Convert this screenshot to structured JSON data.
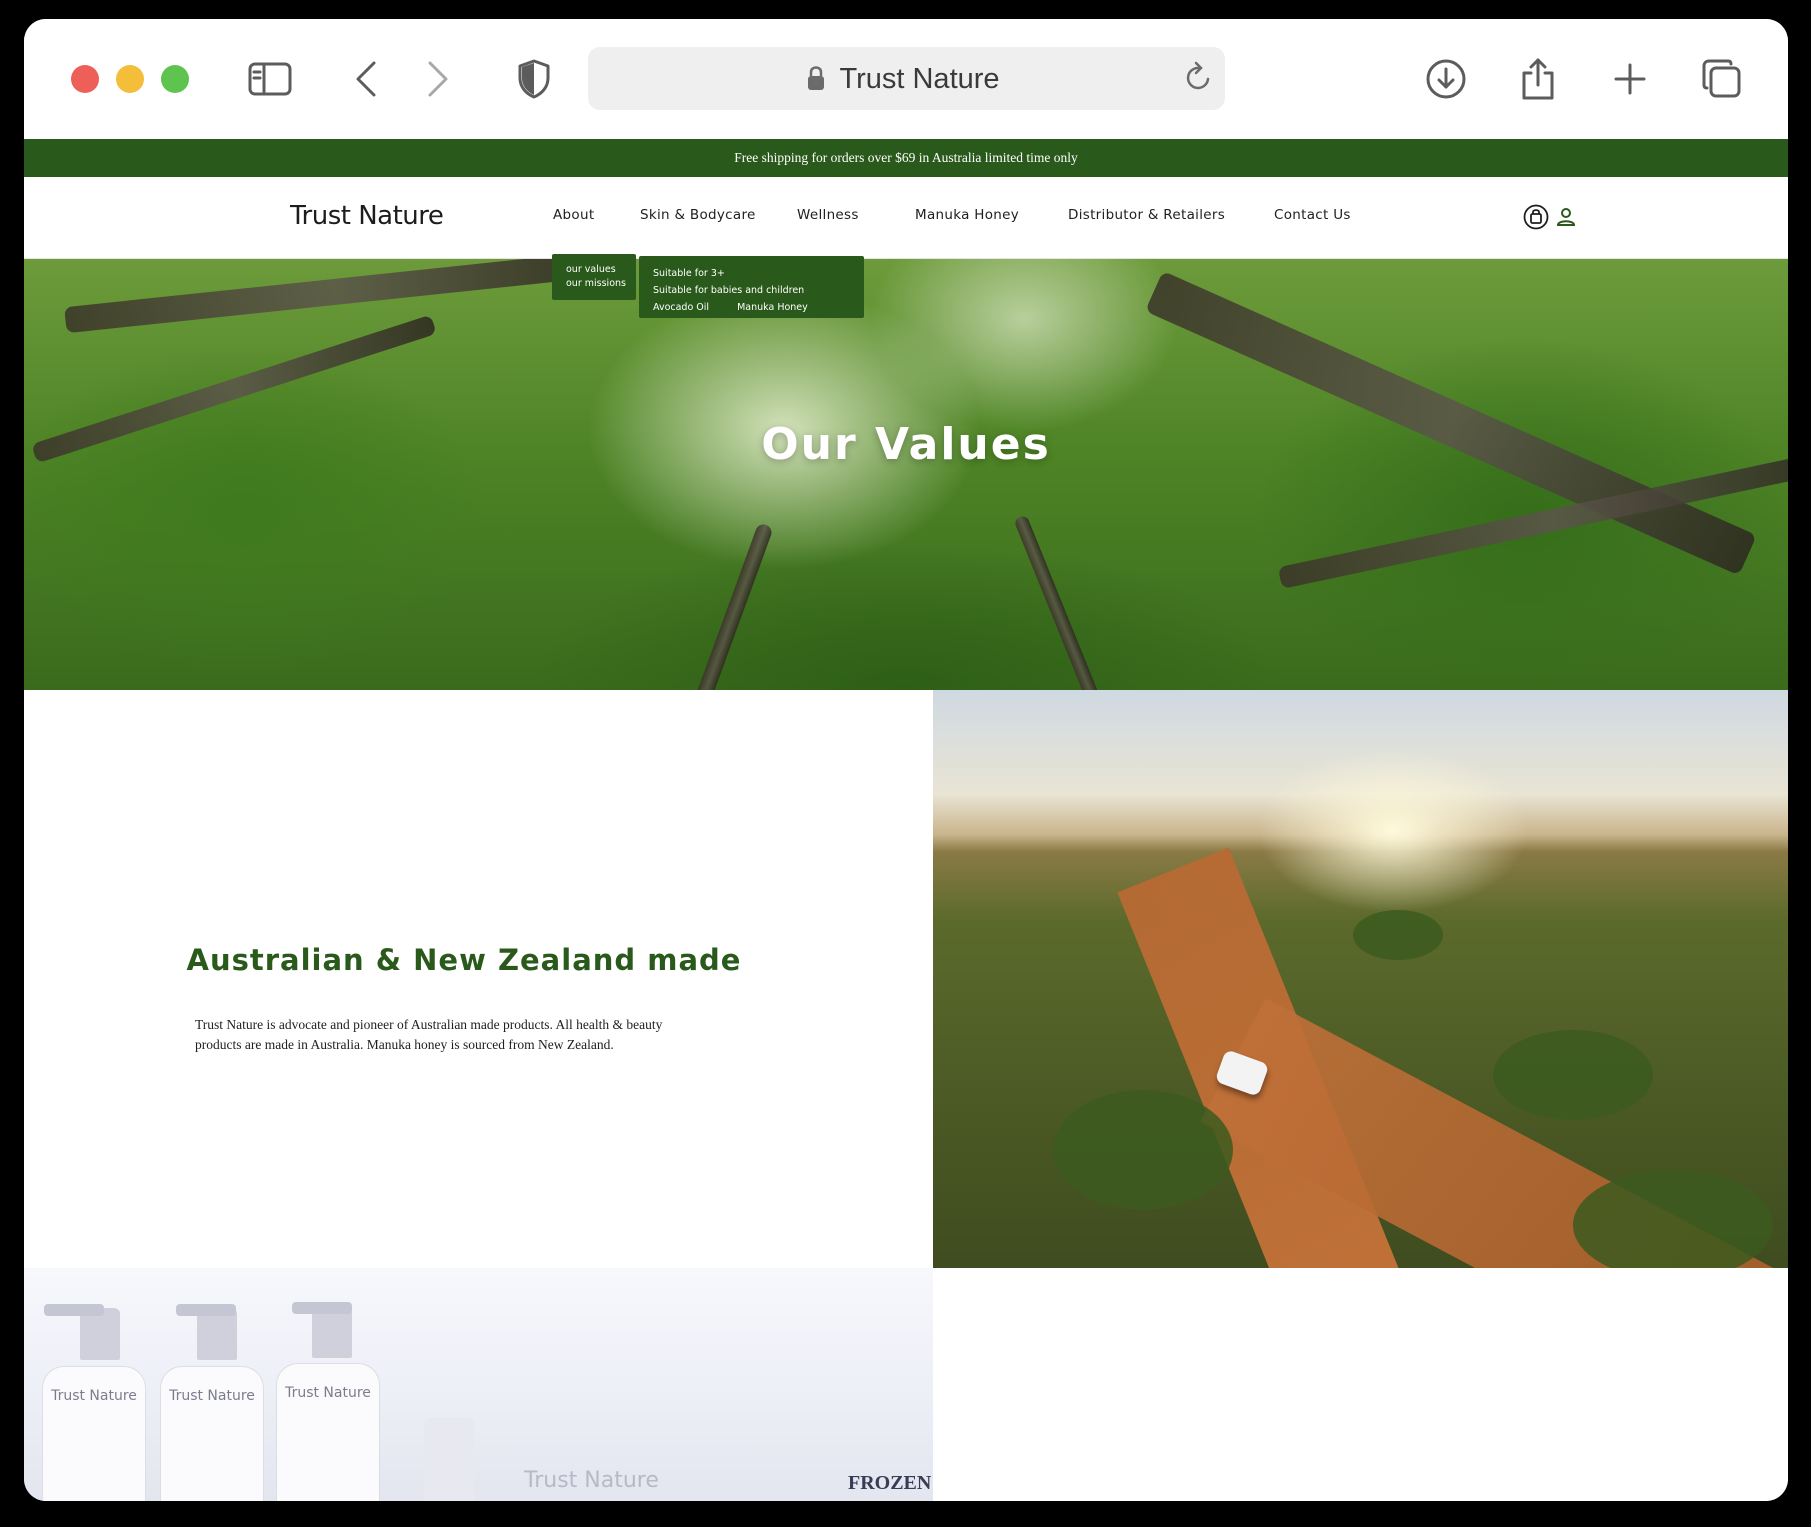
{
  "browser": {
    "address_title": "Trust Nature",
    "icons": [
      "sidebar-icon",
      "back-icon",
      "forward-icon",
      "shield-icon",
      "lock-icon",
      "reload-icon",
      "download-icon",
      "share-icon",
      "new-tab-icon",
      "tabs-icon"
    ]
  },
  "promo": {
    "text": "Free shipping for orders over $69 in Australia limited time only"
  },
  "header": {
    "logo": "Trust Nature",
    "nav": [
      {
        "label": "About"
      },
      {
        "label": "Skin & Bodycare"
      },
      {
        "label": "Wellness"
      },
      {
        "label": "Manuka Honey"
      },
      {
        "label": "Distributor & Retailers"
      },
      {
        "label": "Contact Us"
      }
    ],
    "icons": [
      "cart-icon",
      "account-icon"
    ]
  },
  "dropdowns": {
    "about": [
      "our values",
      "our missions"
    ],
    "skin": [
      "Suitable for 3+",
      "Suitable for babies and children",
      "Avocado Oil",
      "Manuka Honey"
    ]
  },
  "hero": {
    "title": "Our Values"
  },
  "made": {
    "heading": "Australian & New Zealand made",
    "text": "Trust Nature is advocate and pioneer of Australian made products. All health & beauty products are made in Australia. Manuka honey is sourced from New Zealand."
  },
  "products": {
    "bottle_labels": [
      "Trust Nature",
      "Trust Nature",
      "Trust Nature"
    ],
    "box_brand": "Trust Nature",
    "box_title": "FROZEN"
  },
  "colors": {
    "brand_green": "#2a5a1b",
    "promo_bg": "#2a5a1b",
    "heading_green": "#2a5a1b"
  }
}
